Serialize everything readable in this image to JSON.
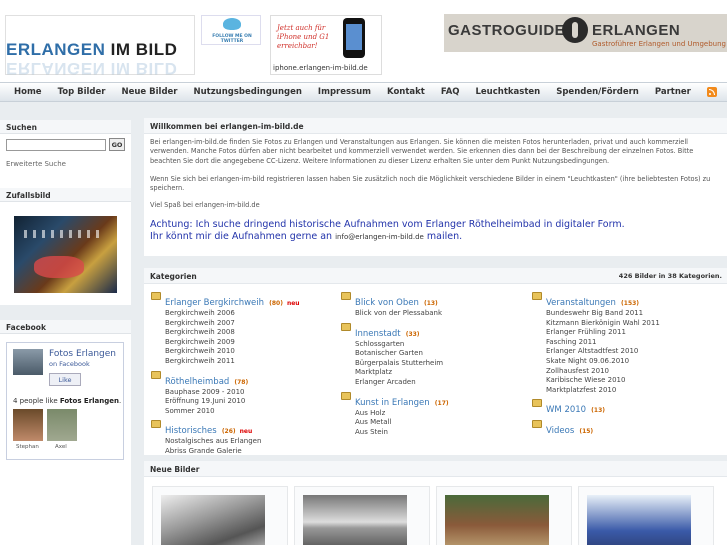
{
  "header": {
    "logo": {
      "word1": "ERLANGEN",
      "word2": "IM BILD"
    },
    "twitter": {
      "label": "FOLLOW ME ON TWITTER"
    },
    "iphone": {
      "ad": "Jetzt auch für iPhone und G1 erreichbar!",
      "url": "iphone.erlangen-im-bild.de"
    },
    "gastroguide": {
      "left": "GASTROGUIDE",
      "right": "ERLANGEN",
      "subtitle": "Gastroführer Erlangen und Umgebung"
    }
  },
  "nav": {
    "items": [
      "Home",
      "Top Bilder",
      "Neue Bilder",
      "Nutzungsbedingungen",
      "Impressum",
      "Kontakt",
      "FAQ",
      "Leuchtkasten",
      "Spenden/Fördern",
      "Partner"
    ],
    "rss_icon": "rss-icon"
  },
  "sidebar": {
    "search": {
      "title": "Suchen",
      "go": "GO",
      "advanced": "Erweiterte Suche",
      "value": ""
    },
    "random": {
      "title": "Zufallsbild"
    },
    "facebook": {
      "title": "Facebook",
      "page_name": "Fotos Erlangen",
      "on_facebook": "on Facebook",
      "like": "Like",
      "people_prefix": "4 people like ",
      "people_page": "Fotos Erlangen",
      "people_suffix": ".",
      "friends": [
        "Stephan",
        "Axel"
      ]
    }
  },
  "welcome": {
    "title": "Willkommen bei erlangen-im-bild.de",
    "p1": "Bei erlangen-im-bild.de finden Sie Fotos zu Erlangen und Veranstaltungen aus Erlangen. Sie können die meisten Fotos herunterladen, privat und auch kommerziell verwenden. Manche Fotos dürfen aber nicht bearbeitet und kommerziell verwendet werden. Sie erkennen dies dann bei der Beschreibung der einzelnen Fotos. Bitte beachten Sie dort die angegebene CC-Lizenz. Weitere Informationen zu dieser Lizenz erhalten Sie unter dem Punkt Nutzungsbedingungen.",
    "p2": "Wenn Sie sich bei erlangen-im-bild registrieren lassen haben Sie zusätzlich noch die Möglichkeit verschiedene Bilder in einem \"Leuchtkasten\" (ihre beliebtesten Fotos) zu speichern.",
    "p3": "Viel Spaß bei erlangen-im-bild.de",
    "notice_line1": "Achtung: Ich suche dringend historische Aufnahmen vom Erlanger Röthelheimbad in digitaler Form.",
    "notice_line2_a": "Ihr könnt mir die Aufnahmen gerne an ",
    "notice_email": "info@erlangen-im-bild.de",
    "notice_line2_b": " mailen."
  },
  "categories": {
    "title": "Kategorien",
    "count": "426 Bilder in 38 Kategorien.",
    "columns": [
      [
        {
          "name": "Erlanger Bergkirchweih",
          "count": "(80)",
          "neu": "neu",
          "subs": [
            "Bergkirchweih 2006",
            "Bergkirchweih 2007",
            "Bergkirchweih 2008",
            "Bergkirchweih 2009",
            "Bergkirchweih 2010",
            "Bergkirchweih 2011"
          ]
        },
        {
          "name": "Röthelheimbad",
          "count": "(78)",
          "neu": "",
          "subs": [
            "Bauphase 2009 - 2010",
            "Eröffnung 19.Juni 2010",
            "Sommer 2010"
          ]
        },
        {
          "name": "Historisches",
          "count": "(26)",
          "neu": "neu",
          "subs": [
            "Nostalgisches aus Erlangen",
            "Abriss Grande Galerie"
          ]
        }
      ],
      [
        {
          "name": "Blick von Oben",
          "count": "(13)",
          "neu": "",
          "subs": [
            "Blick von der Plessabank"
          ]
        },
        {
          "name": "Innenstadt",
          "count": "(33)",
          "neu": "",
          "subs": [
            "Schlossgarten",
            "Botanischer Garten",
            "Bürgerpalais Stutterheim",
            "Marktplatz",
            "Erlanger Arcaden"
          ]
        },
        {
          "name": "Kunst in Erlangen",
          "count": "(17)",
          "neu": "",
          "subs": [
            "Aus Holz",
            "Aus Metall",
            "Aus Stein"
          ]
        }
      ],
      [
        {
          "name": "Veranstaltungen",
          "count": "(153)",
          "neu": "",
          "subs": [
            "Bundeswehr Big Band 2011",
            "Kitzmann Bierkönigin Wahl 2011",
            "Erlanger Frühling 2011",
            "Fasching 2011",
            "Erlanger Altstadtfest 2010",
            "Skate Night 09.06.2010",
            "Zollhausfest 2010",
            "Karibische Wiese 2010",
            "Marktplatzfest 2010"
          ]
        },
        {
          "name": "WM 2010",
          "count": "(13)",
          "neu": "",
          "subs": []
        },
        {
          "name": "Videos",
          "count": "(15)",
          "neu": "",
          "subs": []
        }
      ]
    ]
  },
  "new_images": {
    "title": "Neue Bilder"
  }
}
